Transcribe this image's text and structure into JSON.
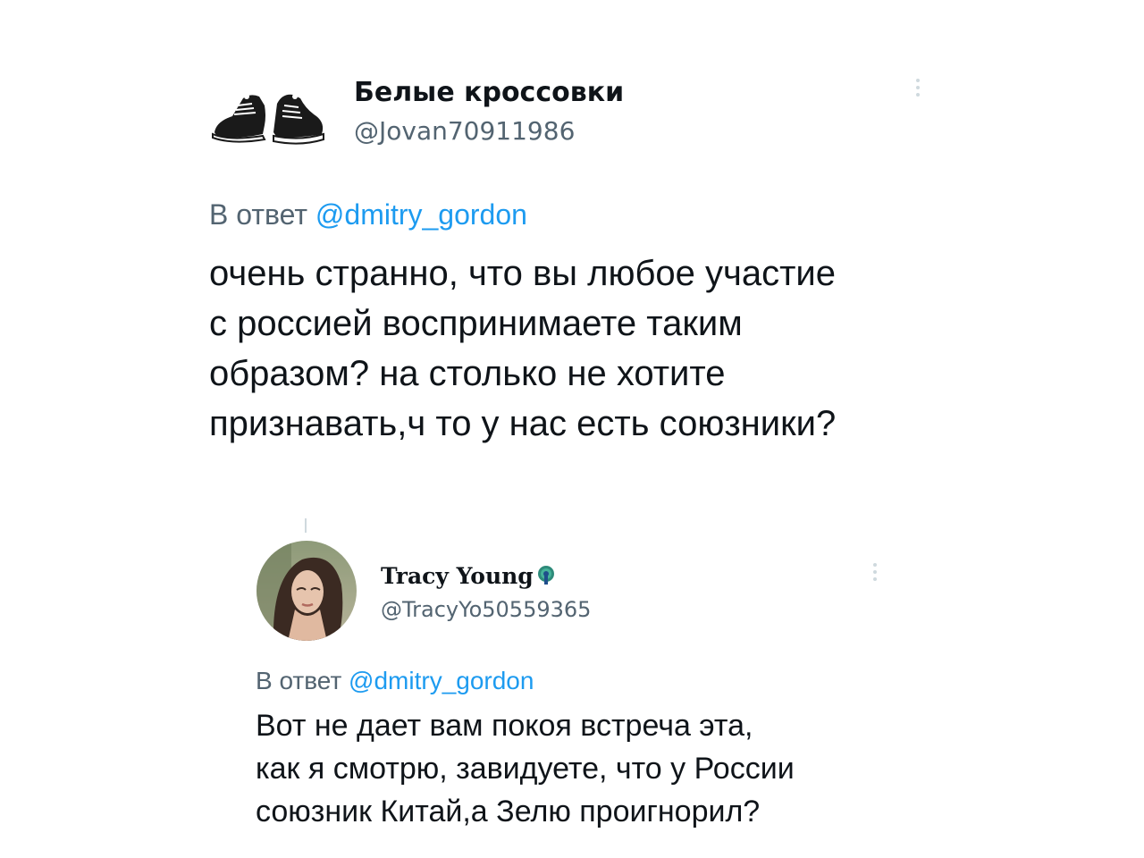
{
  "tweet1": {
    "author_name": "Белые кроссовки",
    "handle": "@Jovan70911986",
    "reply_prefix": "В ответ",
    "reply_mention": "@dmitry_gordon",
    "text_lines": [
      "очень странно, что вы любое участие",
      "с россией воспринимаете таким",
      "образом? на столько не хотите",
      "признавать,ч то у нас есть союзники?"
    ],
    "avatar_icon": "sneakers-icon",
    "more_icon": "more-dots-icon"
  },
  "tweet2": {
    "author_name": "Tracy Young",
    "handle": "@TracyYo50559365",
    "reply_prefix": "В ответ",
    "reply_mention": "@dmitry_gordon",
    "text_lines": [
      "Вот не дает вам покоя встреча эта,",
      "как я смотрю, завидуете, что у  России",
      "союзник Китай,а  Зелю проигнорил?"
    ],
    "avatar_icon": "profile-photo-icon",
    "badge_icon": "peacock-icon",
    "more_icon": "more-dots-icon"
  },
  "colors": {
    "text": "#0f1419",
    "secondary": "#536471",
    "mention": "#1d9bf0",
    "divider": "#cfd9de"
  }
}
